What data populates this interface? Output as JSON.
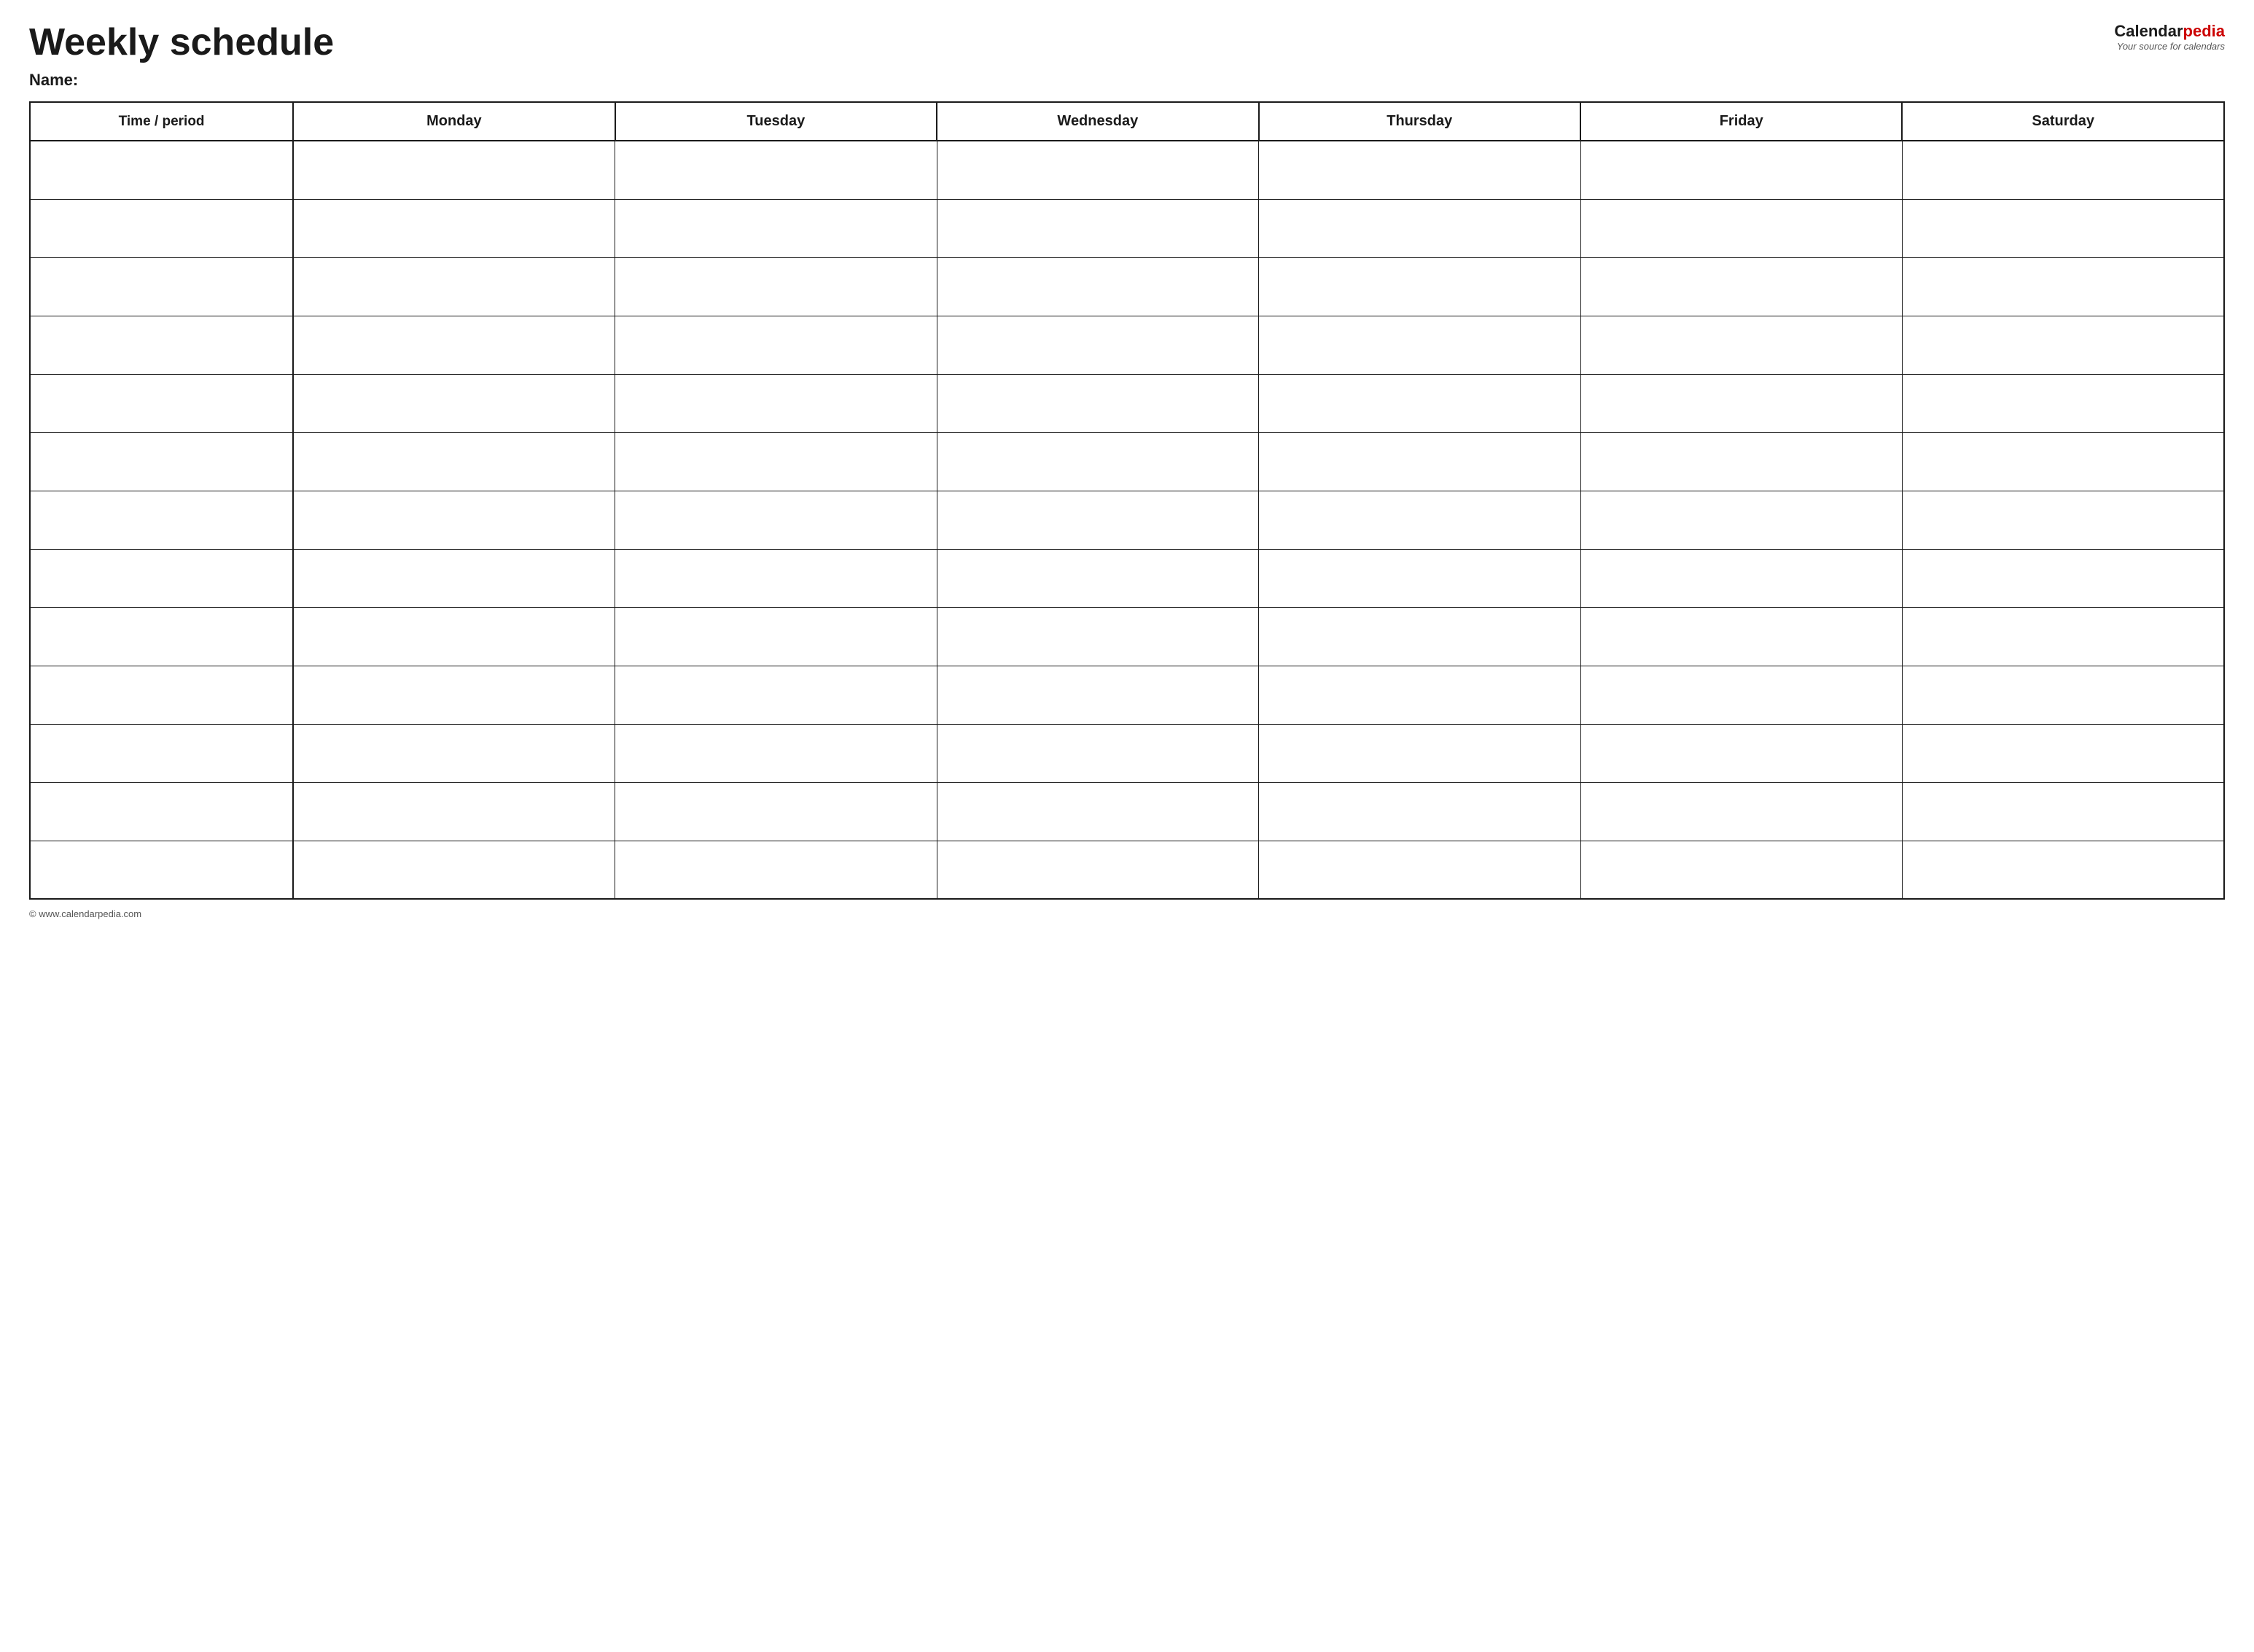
{
  "header": {
    "title": "Weekly schedule",
    "logo": {
      "calendar_text": "Calendar",
      "pedia_text": "pedia",
      "tagline": "Your source for calendars"
    },
    "name_label": "Name:"
  },
  "table": {
    "columns": [
      {
        "key": "time",
        "label": "Time / period"
      },
      {
        "key": "monday",
        "label": "Monday"
      },
      {
        "key": "tuesday",
        "label": "Tuesday"
      },
      {
        "key": "wednesday",
        "label": "Wednesday"
      },
      {
        "key": "thursday",
        "label": "Thursday"
      },
      {
        "key": "friday",
        "label": "Friday"
      },
      {
        "key": "saturday",
        "label": "Saturday"
      }
    ],
    "row_count": 13
  },
  "footer": {
    "url": "© www.calendarpedia.com"
  }
}
